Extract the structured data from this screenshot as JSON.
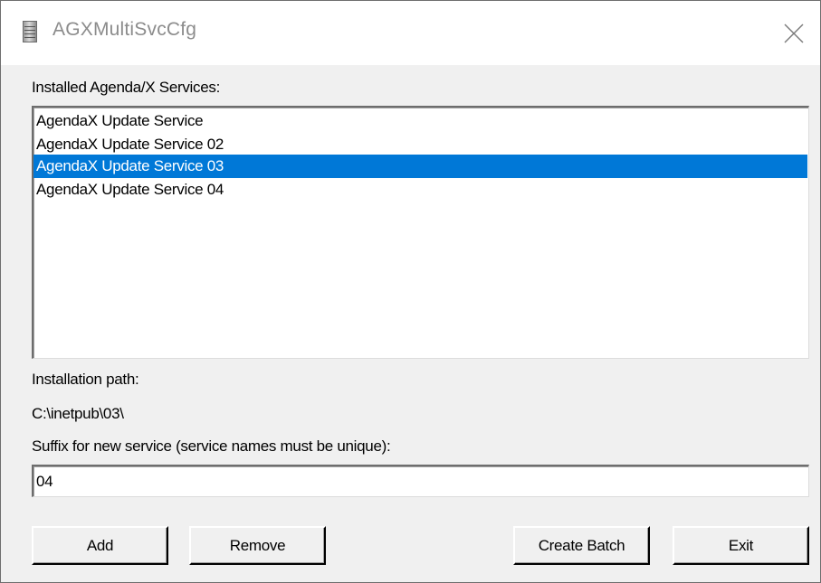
{
  "window": {
    "title": "AGXMultiSvcCfg",
    "app_icon": "cylinder-icon",
    "close_icon": "close-icon"
  },
  "services": {
    "label": "Installed Agenda/X Services:",
    "items": [
      {
        "label": "AgendaX Update Service",
        "selected": false
      },
      {
        "label": "AgendaX Update Service 02",
        "selected": false
      },
      {
        "label": "AgendaX Update Service 03",
        "selected": true
      },
      {
        "label": "AgendaX Update Service 04",
        "selected": false
      }
    ]
  },
  "installation": {
    "label": "Installation path:",
    "path": "C:\\inetpub\\03\\"
  },
  "suffix": {
    "label": "Suffix for new service (service names must be unique):",
    "value": "04"
  },
  "buttons": {
    "add": "Add",
    "remove": "Remove",
    "create_batch": "Create Batch",
    "exit": "Exit"
  },
  "colors": {
    "selection": "#0078d7",
    "window_bg": "#f0f0f0",
    "title_text": "#8c8c8c"
  }
}
